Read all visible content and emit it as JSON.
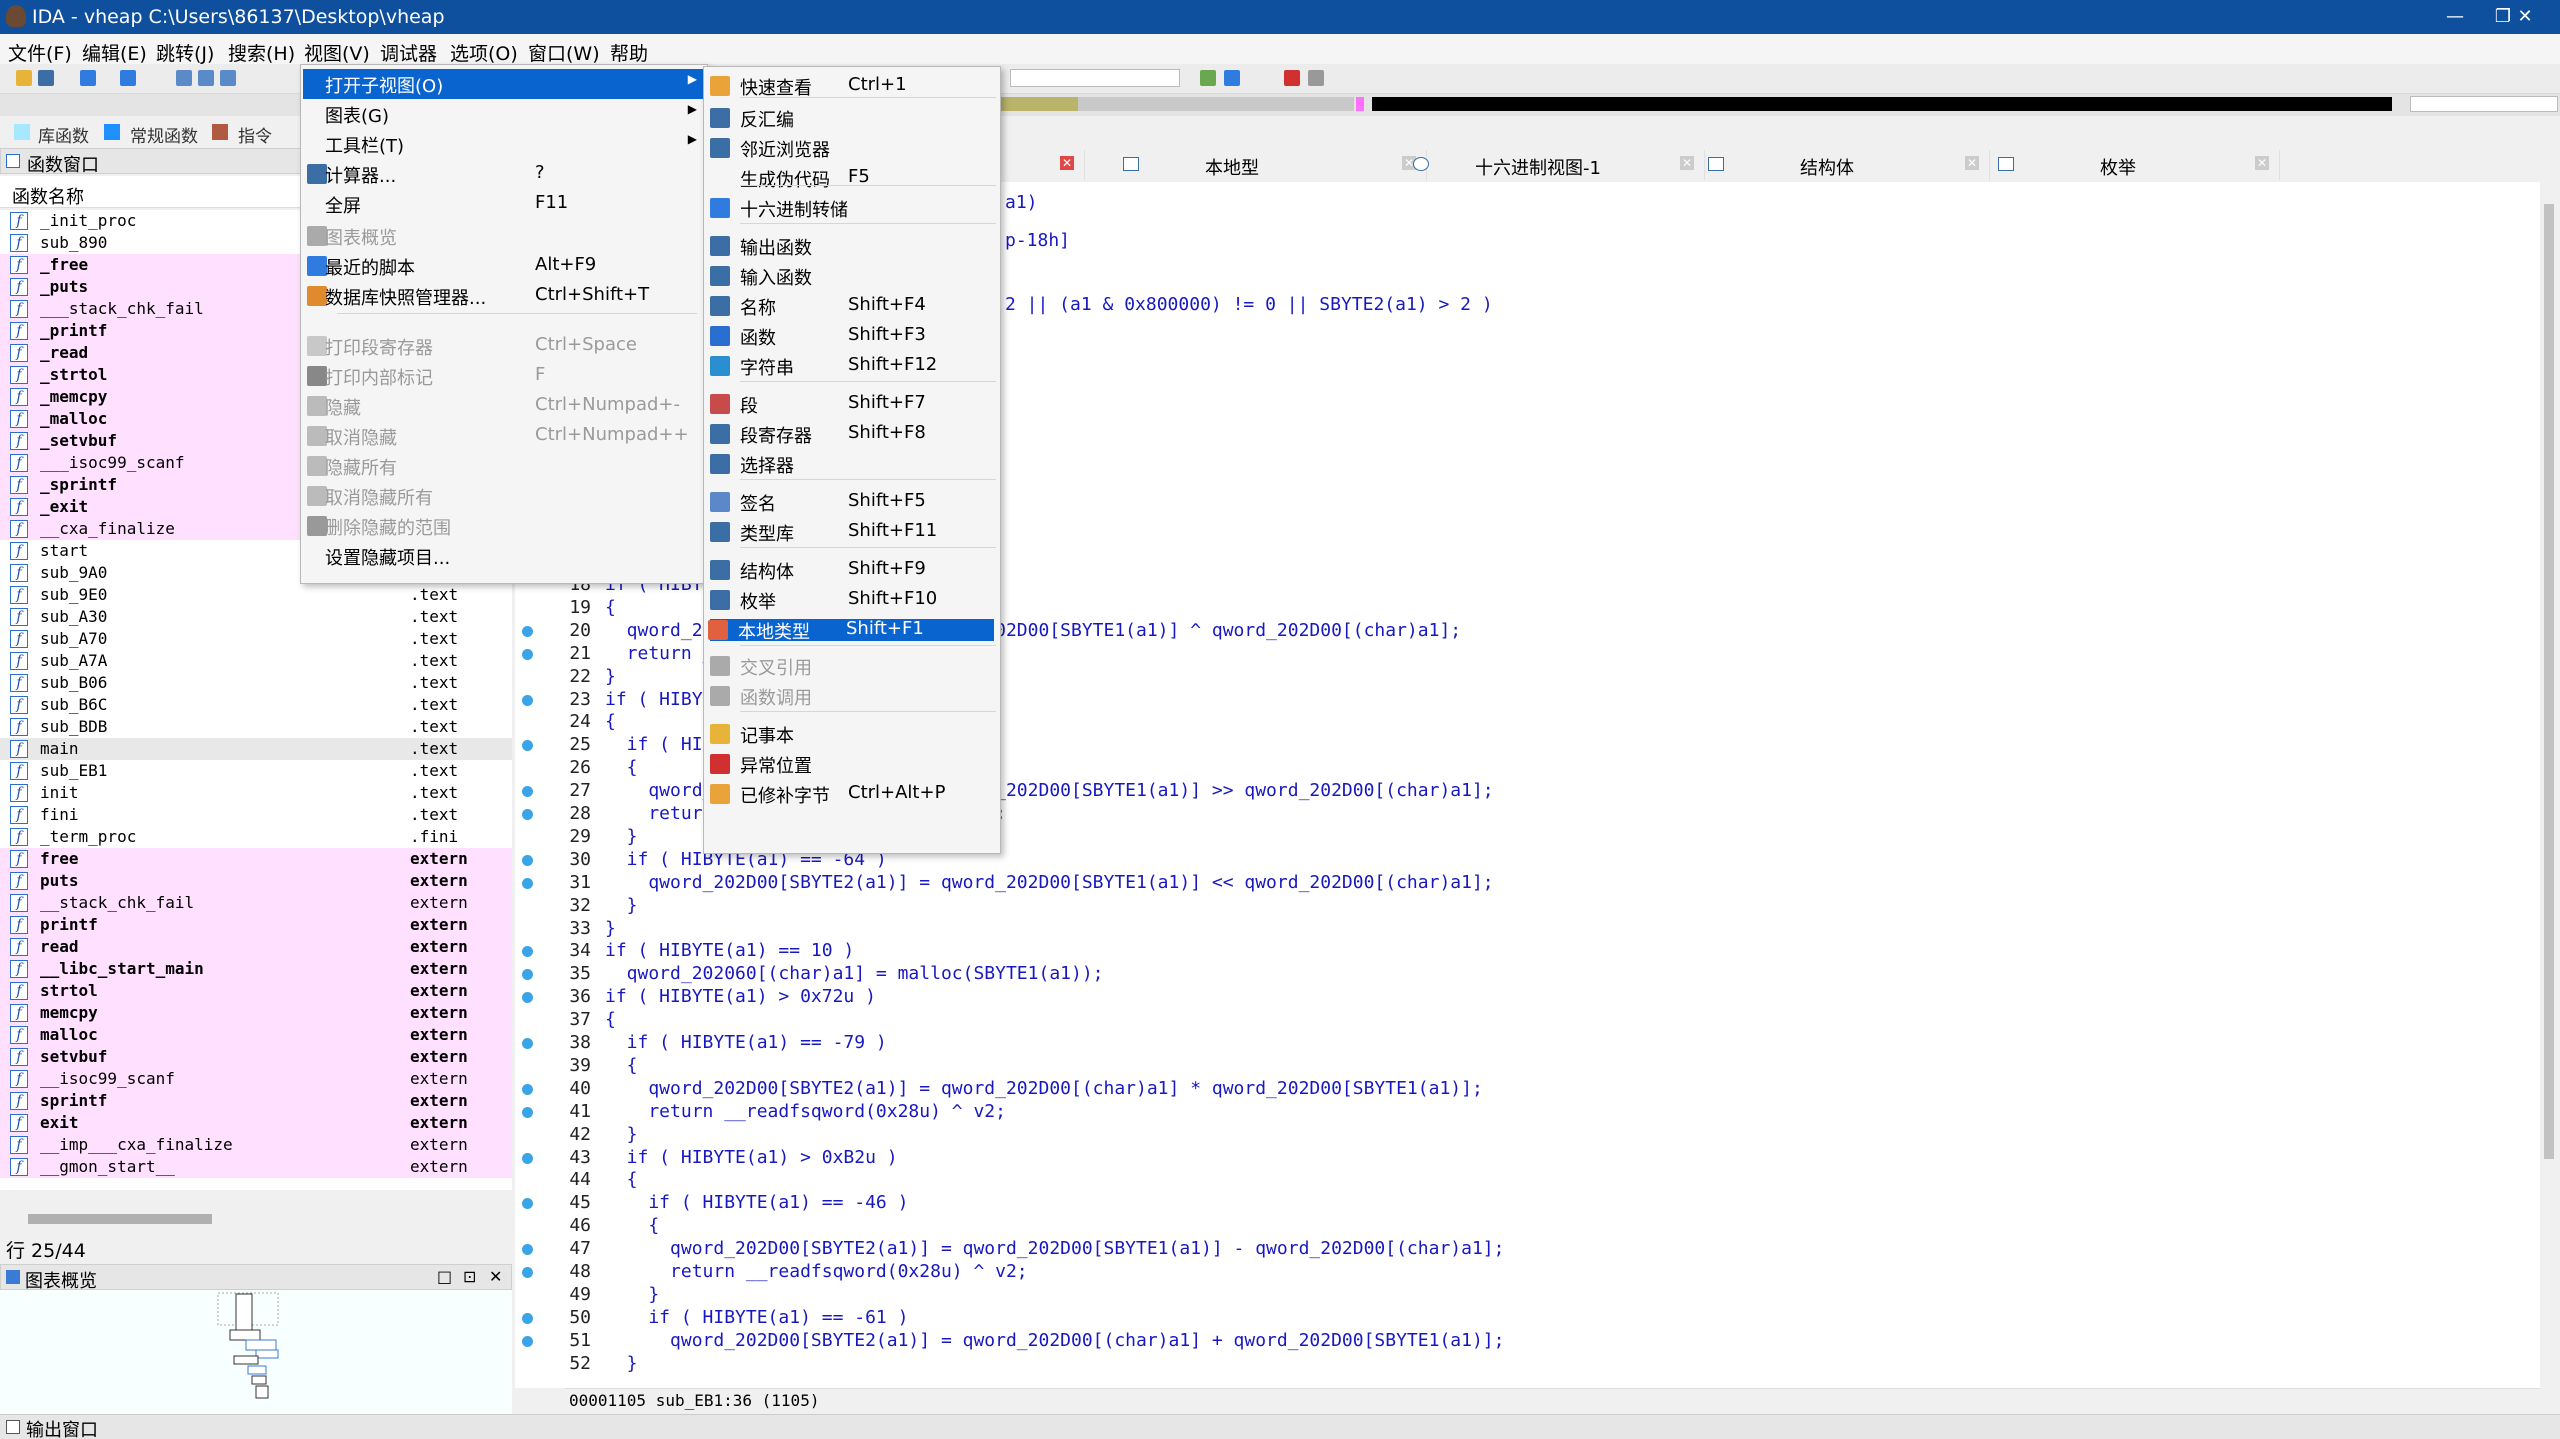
{
  "window": {
    "title": "IDA - vheap C:\\Users\\86137\\Desktop\\vheap",
    "buttons": [
      "—",
      "❐",
      "✕"
    ]
  },
  "menubar": [
    "文件(F)",
    "编辑(E)",
    "跳转(J)",
    "搜索(H)",
    "视图(V)",
    "调试器",
    "选项(O)",
    "窗口(W)",
    "帮助"
  ],
  "legend": [
    {
      "label": "库函数",
      "color": "#a8e8ff"
    },
    {
      "label": "常规函数",
      "color": "#1e90ff"
    },
    {
      "label": "指令",
      "color": "#b05a42"
    }
  ],
  "functions_window": {
    "title": "函数窗口",
    "header": "函数名称",
    "rows": [
      {
        "name": "_init_proc",
        "seg": ""
      },
      {
        "name": "sub_890",
        "seg": ""
      },
      {
        "name": "_free",
        "seg": ""
      },
      {
        "name": "_puts",
        "seg": ""
      },
      {
        "name": "___stack_chk_fail",
        "seg": ""
      },
      {
        "name": "_printf",
        "seg": ""
      },
      {
        "name": "_read",
        "seg": ""
      },
      {
        "name": "_strtol",
        "seg": ""
      },
      {
        "name": "_memcpy",
        "seg": ""
      },
      {
        "name": "_malloc",
        "seg": ""
      },
      {
        "name": "_setvbuf",
        "seg": ""
      },
      {
        "name": "___isoc99_scanf",
        "seg": ""
      },
      {
        "name": "_sprintf",
        "seg": ""
      },
      {
        "name": "_exit",
        "seg": ""
      },
      {
        "name": "__cxa_finalize",
        "seg": ""
      },
      {
        "name": "start",
        "seg": ""
      },
      {
        "name": "sub_9A0",
        "seg": ".text"
      },
      {
        "name": "sub_9E0",
        "seg": ".text"
      },
      {
        "name": "sub_A30",
        "seg": ".text"
      },
      {
        "name": "sub_A70",
        "seg": ".text"
      },
      {
        "name": "sub_A7A",
        "seg": ".text"
      },
      {
        "name": "sub_B06",
        "seg": ".text"
      },
      {
        "name": "sub_B6C",
        "seg": ".text"
      },
      {
        "name": "sub_BDB",
        "seg": ".text"
      },
      {
        "name": "main",
        "seg": ".text"
      },
      {
        "name": "sub_EB1",
        "seg": ".text"
      },
      {
        "name": "init",
        "seg": ".text"
      },
      {
        "name": "fini",
        "seg": ".text"
      },
      {
        "name": "_term_proc",
        "seg": ".fini"
      },
      {
        "name": "free",
        "seg": "extern"
      },
      {
        "name": "puts",
        "seg": "extern"
      },
      {
        "name": "__stack_chk_fail",
        "seg": "extern"
      },
      {
        "name": "printf",
        "seg": "extern"
      },
      {
        "name": "read",
        "seg": "extern"
      },
      {
        "name": "__libc_start_main",
        "seg": "extern"
      },
      {
        "name": "strtol",
        "seg": "extern"
      },
      {
        "name": "memcpy",
        "seg": "extern"
      },
      {
        "name": "malloc",
        "seg": "extern"
      },
      {
        "name": "setvbuf",
        "seg": "extern"
      },
      {
        "name": "__isoc99_scanf",
        "seg": "extern"
      },
      {
        "name": "sprintf",
        "seg": "extern"
      },
      {
        "name": "exit",
        "seg": "extern"
      },
      {
        "name": "__imp___cxa_finalize",
        "seg": "extern"
      },
      {
        "name": "__gmon_start__",
        "seg": "extern"
      }
    ],
    "row_status": "行 25/44"
  },
  "graph_overview": {
    "title": "图表概览",
    "buttons": [
      "□",
      "⊡",
      "✕"
    ]
  },
  "tabs": [
    {
      "label": "",
      "icon": "pseudocode-icon"
    },
    {
      "label": "本地型",
      "icon": "local-types-icon"
    },
    {
      "label": "十六进制视图-1",
      "icon": "hex-view-icon"
    },
    {
      "label": "结构体",
      "icon": "structures-icon"
    },
    {
      "label": "枚举",
      "icon": "enums-icon"
    }
  ],
  "code": {
    "lines": [
      {
        "num": "",
        "text": "a1)",
        "dot": false
      },
      {
        "num": "",
        "text": "",
        "dot": false
      },
      {
        "num": "",
        "text": "p-18h]",
        "dot": false
      },
      {
        "num": "",
        "text": "",
        "dot": false
      },
      {
        "num": "",
        "text": "",
        "dot": false
      },
      {
        "num": "",
        "text": "2 || (a1 & 0x800000) != 0 || SBYTE2(a1) > 2 )",
        "dot": false
      },
      {
        "num": "18",
        "text": "if ( HIBYTE(a1)",
        "dot": false
      },
      {
        "num": "19",
        "text": "{",
        "dot": false
      },
      {
        "num": "20",
        "text": "  qword_202D00[SBYTE2(a1)] = qword_202D00[SBYTE1(a1)] ^ qword_202D00[(char)a1];",
        "dot": true
      },
      {
        "num": "21",
        "text": "  return __readfsqword(0x28u) ^ v2;",
        "dot": true
      },
      {
        "num": "22",
        "text": "}",
        "dot": false
      },
      {
        "num": "23",
        "text": "if ( HIBYTE(a1)",
        "dot": true
      },
      {
        "num": "24",
        "text": "{",
        "dot": false
      },
      {
        "num": "25",
        "text": "  if ( HIBYTE(a1)",
        "dot": true
      },
      {
        "num": "26",
        "text": "  {",
        "dot": false
      },
      {
        "num": "27",
        "text": "    qword_202D00[SBYTE2(a1)] = qword_202D00[SBYTE1(a1)] >> qword_202D00[(char)a1];",
        "dot": true
      },
      {
        "num": "28",
        "text": "    return __readfsqword(0x28u) ^ v2;",
        "dot": true
      },
      {
        "num": "29",
        "text": "  }",
        "dot": false
      },
      {
        "num": "30",
        "text": "  if ( HIBYTE(a1) == -64 )",
        "dot": true
      },
      {
        "num": "31",
        "text": "    qword_202D00[SBYTE2(a1)] = qword_202D00[SBYTE1(a1)] << qword_202D00[(char)a1];",
        "dot": true
      },
      {
        "num": "32",
        "text": "  }",
        "dot": false
      },
      {
        "num": "33",
        "text": "}",
        "dot": false
      },
      {
        "num": "34",
        "text": "if ( HIBYTE(a1) == 10 )",
        "dot": true
      },
      {
        "num": "35",
        "text": "  qword_202060[(char)a1] = malloc(SBYTE1(a1));",
        "dot": true
      },
      {
        "num": "36",
        "text": "if ( HIBYTE(a1) > 0x72u )",
        "dot": true
      },
      {
        "num": "37",
        "text": "{",
        "dot": false
      },
      {
        "num": "38",
        "text": "  if ( HIBYTE(a1) == -79 )",
        "dot": true
      },
      {
        "num": "39",
        "text": "  {",
        "dot": false
      },
      {
        "num": "40",
        "text": "    qword_202D00[SBYTE2(a1)] = qword_202D00[(char)a1] * qword_202D00[SBYTE1(a1)];",
        "dot": true
      },
      {
        "num": "41",
        "text": "    return __readfsqword(0x28u) ^ v2;",
        "dot": true
      },
      {
        "num": "42",
        "text": "  }",
        "dot": false
      },
      {
        "num": "43",
        "text": "  if ( HIBYTE(a1) > 0xB2u )",
        "dot": true
      },
      {
        "num": "44",
        "text": "  {",
        "dot": false
      },
      {
        "num": "45",
        "text": "    if ( HIBYTE(a1) == -46 )",
        "dot": true
      },
      {
        "num": "46",
        "text": "    {",
        "dot": false
      },
      {
        "num": "47",
        "text": "      qword_202D00[SBYTE2(a1)] = qword_202D00[SBYTE1(a1)] - qword_202D00[(char)a1];",
        "dot": true
      },
      {
        "num": "48",
        "text": "      return __readfsqword(0x28u) ^ v2;",
        "dot": true
      },
      {
        "num": "49",
        "text": "    }",
        "dot": false
      },
      {
        "num": "50",
        "text": "    if ( HIBYTE(a1) == -61 )",
        "dot": true
      },
      {
        "num": "51",
        "text": "      qword_202D00[SBYTE2(a1)] = qword_202D00[(char)a1] + qword_202D00[SBYTE1(a1)];",
        "dot": true
      },
      {
        "num": "52",
        "text": "  }",
        "dot": false
      }
    ],
    "status": "00001105 sub_EB1:36 (1105)"
  },
  "output_window": {
    "title": "输出窗口"
  },
  "menu1": {
    "items": [
      {
        "label": "打开子视图(O)",
        "shortcut": "",
        "submenu": true,
        "highlight": true,
        "disabled": false,
        "icon": ""
      },
      {
        "label": "图表(G)",
        "shortcut": "",
        "submenu": true,
        "highlight": false,
        "disabled": false,
        "icon": ""
      },
      {
        "label": "工具栏(T)",
        "shortcut": "",
        "submenu": true,
        "highlight": false,
        "disabled": false,
        "icon": ""
      },
      {
        "label": "计算器...",
        "shortcut": "?",
        "submenu": false,
        "highlight": false,
        "disabled": false,
        "icon": "calculator-icon"
      },
      {
        "label": "全屏",
        "shortcut": "F11",
        "submenu": false,
        "highlight": false,
        "disabled": false,
        "icon": ""
      },
      {
        "label": "图表概览",
        "shortcut": "",
        "submenu": false,
        "highlight": false,
        "disabled": true,
        "icon": "graph-overview-icon"
      },
      {
        "label": "最近的脚本",
        "shortcut": "Alt+F9",
        "submenu": false,
        "highlight": false,
        "disabled": false,
        "icon": "script-icon"
      },
      {
        "label": "数据库快照管理器...",
        "shortcut": "Ctrl+Shift+T",
        "submenu": false,
        "highlight": false,
        "disabled": false,
        "icon": "snapshot-icon"
      },
      {
        "label": "打印段寄存器",
        "shortcut": "Ctrl+Space",
        "submenu": false,
        "highlight": false,
        "disabled": true,
        "icon": "segreg-icon"
      },
      {
        "label": "打印内部标记",
        "shortcut": "F",
        "submenu": false,
        "highlight": false,
        "disabled": true,
        "icon": "info-icon"
      },
      {
        "label": "隐藏",
        "shortcut": "Ctrl+Numpad+-",
        "submenu": false,
        "highlight": false,
        "disabled": true,
        "icon": "minus-icon"
      },
      {
        "label": "取消隐藏",
        "shortcut": "Ctrl+Numpad++",
        "submenu": false,
        "highlight": false,
        "disabled": true,
        "icon": "plus-icon"
      },
      {
        "label": "隐藏所有",
        "shortcut": "",
        "submenu": false,
        "highlight": false,
        "disabled": true,
        "icon": "minus-all-icon"
      },
      {
        "label": "取消隐藏所有",
        "shortcut": "",
        "submenu": false,
        "highlight": false,
        "disabled": true,
        "icon": "plus-all-icon"
      },
      {
        "label": "删除隐藏的范围",
        "shortcut": "",
        "submenu": false,
        "highlight": false,
        "disabled": true,
        "icon": "delete-icon"
      },
      {
        "label": "设置隐藏项目...",
        "shortcut": "",
        "submenu": false,
        "highlight": false,
        "disabled": false,
        "icon": ""
      }
    ]
  },
  "menu2": {
    "items": [
      {
        "label": "快速查看",
        "shortcut": "Ctrl+1",
        "disabled": false,
        "highlight": false,
        "icon": "quick-view-icon"
      },
      {
        "label": "反汇编",
        "shortcut": "",
        "disabled": false,
        "highlight": false,
        "icon": "disassembly-icon"
      },
      {
        "label": "邻近浏览器",
        "shortcut": "",
        "disabled": false,
        "highlight": false,
        "icon": "proximity-icon"
      },
      {
        "label": "生成伪代码",
        "shortcut": "F5",
        "disabled": false,
        "highlight": false,
        "icon": ""
      },
      {
        "label": "十六进制转储",
        "shortcut": "",
        "disabled": false,
        "highlight": false,
        "icon": "hex-dump-icon"
      },
      {
        "label": "输出函数",
        "shortcut": "",
        "disabled": false,
        "highlight": false,
        "icon": "exports-icon"
      },
      {
        "label": "输入函数",
        "shortcut": "",
        "disabled": false,
        "highlight": false,
        "icon": "imports-icon"
      },
      {
        "label": "名称",
        "shortcut": "Shift+F4",
        "disabled": false,
        "highlight": false,
        "icon": "names-icon"
      },
      {
        "label": "函数",
        "shortcut": "Shift+F3",
        "disabled": false,
        "highlight": false,
        "icon": "functions-icon"
      },
      {
        "label": "字符串",
        "shortcut": "Shift+F12",
        "disabled": false,
        "highlight": false,
        "icon": "strings-icon"
      },
      {
        "label": "段",
        "shortcut": "Shift+F7",
        "disabled": false,
        "highlight": false,
        "icon": "segments-icon"
      },
      {
        "label": "段寄存器",
        "shortcut": "Shift+F8",
        "disabled": false,
        "highlight": false,
        "icon": "segment-registers-icon"
      },
      {
        "label": "选择器",
        "shortcut": "",
        "disabled": false,
        "highlight": false,
        "icon": "selectors-icon"
      },
      {
        "label": "签名",
        "shortcut": "Shift+F5",
        "disabled": false,
        "highlight": false,
        "icon": "signatures-icon"
      },
      {
        "label": "类型库",
        "shortcut": "Shift+F11",
        "disabled": false,
        "highlight": false,
        "icon": "type-libraries-icon"
      },
      {
        "label": "结构体",
        "shortcut": "Shift+F9",
        "disabled": false,
        "highlight": false,
        "icon": "structures-icon"
      },
      {
        "label": "枚举",
        "shortcut": "Shift+F10",
        "disabled": false,
        "highlight": false,
        "icon": "enums-icon"
      },
      {
        "label": "本地类型",
        "shortcut": "Shift+F1",
        "disabled": false,
        "highlight": true,
        "icon": "local-types-icon"
      },
      {
        "label": "交叉引用",
        "shortcut": "",
        "disabled": true,
        "highlight": false,
        "icon": "xrefs-icon"
      },
      {
        "label": "函数调用",
        "shortcut": "",
        "disabled": true,
        "highlight": false,
        "icon": "function-calls-icon"
      },
      {
        "label": "记事本",
        "shortcut": "",
        "disabled": false,
        "highlight": false,
        "icon": "notepad-icon"
      },
      {
        "label": "异常位置",
        "shortcut": "",
        "disabled": false,
        "highlight": false,
        "icon": "problems-icon"
      },
      {
        "label": "已修补字节",
        "shortcut": "Ctrl+Alt+P",
        "disabled": false,
        "highlight": false,
        "icon": "patched-bytes-icon"
      }
    ]
  }
}
